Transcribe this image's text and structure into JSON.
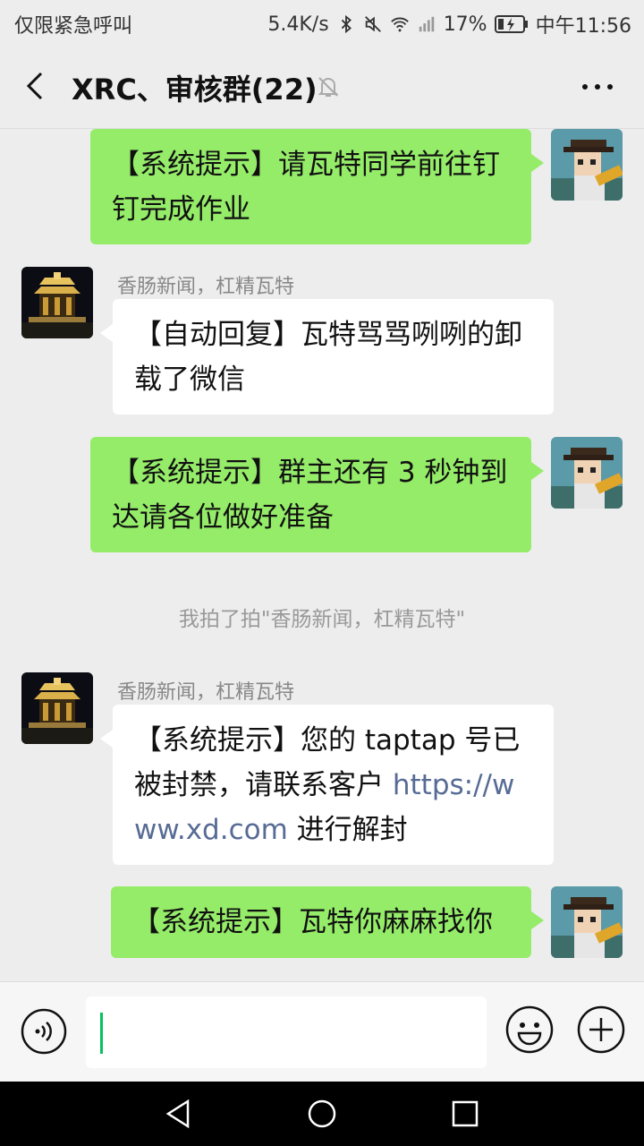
{
  "status_bar": {
    "carrier": "仅限紧急呼叫",
    "speed": "5.4K/s",
    "battery": "17%",
    "time": "中午11:56",
    "icons": [
      "bluetooth-icon",
      "mute-icon",
      "wifi-icon",
      "signal-icon",
      "battery-charging-icon"
    ]
  },
  "header": {
    "title": "XRC、审核群(22)",
    "back_icon": "chevron-left-icon",
    "mute_icon": "bell-off-icon",
    "more_icon": "more-dots-icon"
  },
  "messages": [
    {
      "side": "mine",
      "text": "【系统提示】请瓦特同学前往钉钉完成作业"
    },
    {
      "side": "other",
      "sender": "香肠新闻，杠精瓦特",
      "text": "【自动回复】瓦特骂骂咧咧的卸载了微信"
    },
    {
      "side": "mine",
      "text": "【系统提示】群主还有 3 秒钟到达请各位做好准备"
    },
    {
      "type": "notice",
      "text": "我拍了拍\"香肠新闻，杠精瓦特\""
    },
    {
      "side": "other",
      "sender": "香肠新闻，杠精瓦特",
      "text_before": "【系统提示】您的 taptap 号已被封禁，请联系客户 ",
      "link": "https://www.xd.com",
      "text_after": " 进行解封"
    },
    {
      "side": "mine",
      "text": "【系统提示】瓦特你麻麻找你"
    }
  ],
  "input_bar": {
    "voice_icon": "voice-icon",
    "input_value": "",
    "emoji_icon": "emoji-icon",
    "plus_icon": "plus-icon"
  },
  "colors": {
    "mine_bubble": "#95ec69",
    "other_bubble": "#ffffff",
    "background": "#ededed",
    "link": "#576b95",
    "caret": "#07c160"
  }
}
